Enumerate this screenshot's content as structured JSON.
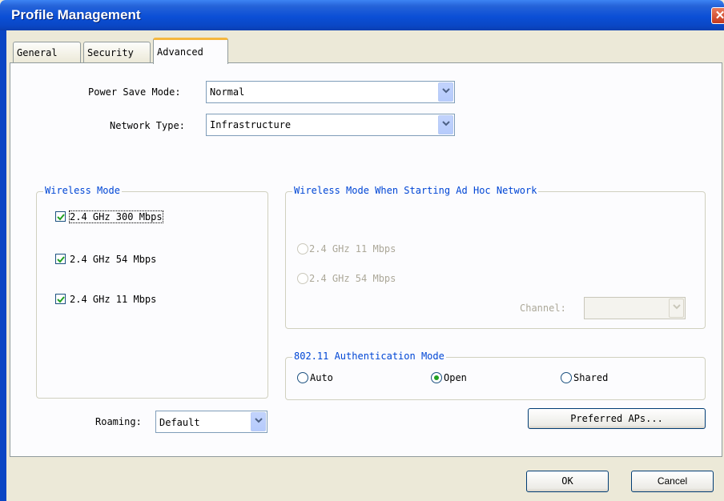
{
  "window": {
    "title": "Profile Management"
  },
  "tabs": [
    {
      "label": "General"
    },
    {
      "label": "Security"
    },
    {
      "label": "Advanced"
    }
  ],
  "power_save": {
    "label": "Power Save Mode:",
    "value": "Normal"
  },
  "network_type": {
    "label": "Network Type:",
    "value": "Infrastructure"
  },
  "wireless_mode": {
    "legend": "Wireless Mode",
    "options": [
      {
        "label": "2.4 GHz 300 Mbps",
        "checked": true
      },
      {
        "label": "2.4 GHz 54 Mbps",
        "checked": true
      },
      {
        "label": "2.4 GHz 11 Mbps",
        "checked": true
      }
    ]
  },
  "adhoc": {
    "legend": "Wireless Mode When Starting Ad Hoc Network",
    "options": [
      {
        "label": "2.4 GHz 11 Mbps",
        "enabled": false
      },
      {
        "label": "2.4 GHz 54 Mbps",
        "enabled": false
      }
    ],
    "channel_label": "Channel:",
    "channel_value": ""
  },
  "auth": {
    "legend": "802.11 Authentication Mode",
    "options": [
      {
        "label": "Auto",
        "selected": false
      },
      {
        "label": "Open",
        "selected": true
      },
      {
        "label": "Shared",
        "selected": false
      }
    ]
  },
  "roaming": {
    "label": "Roaming:",
    "value": "Default"
  },
  "buttons": {
    "preferred_aps": "Preferred APs...",
    "ok": "OK",
    "cancel": "Cancel"
  },
  "colors": {
    "titlebar": "#0a47c5",
    "legend": "#0046d5",
    "tab_highlight": "#f5b73e",
    "dialog_bg": "#ece9d8"
  }
}
